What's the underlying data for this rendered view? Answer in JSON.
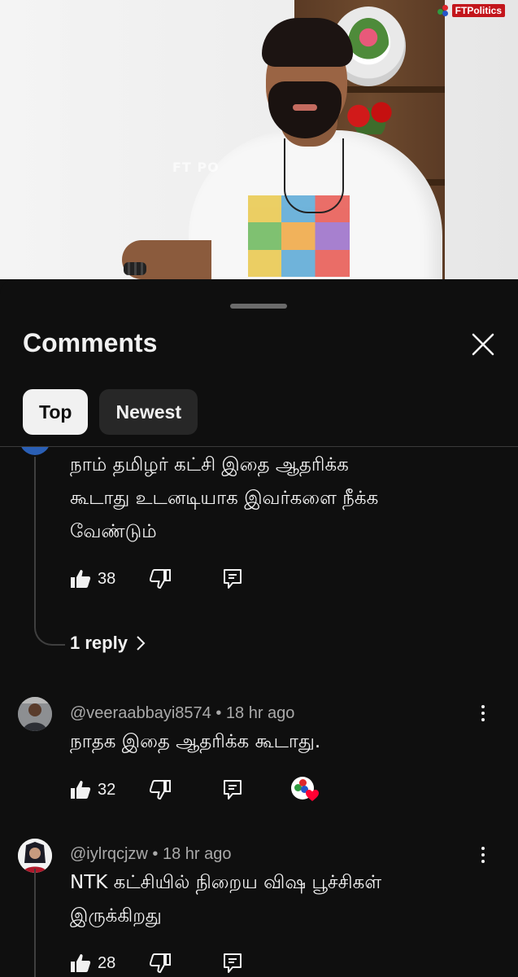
{
  "video": {
    "watermark_center": "FT PO",
    "channel_logo_text": "FTPolitics"
  },
  "sheet": {
    "title": "Comments",
    "sort_chips": [
      {
        "label": "Top",
        "selected": true
      },
      {
        "label": "Newest",
        "selected": false
      }
    ]
  },
  "comments": [
    {
      "text_line1": "நாம் தமிழர் கட்சி இதை ஆதரிக்க",
      "text_line2": "கூடாது உடனடியாக இவர்களை நீக்க",
      "text_line3": "வேண்டும்",
      "likes": "38",
      "replies_label": "1 reply"
    },
    {
      "author": "@veeraabbayi8574",
      "time": "18 hr ago",
      "meta_sep": "•",
      "text_line1": "நாதக இதை ஆதரிக்க கூடாது.",
      "likes": "32",
      "creator_heart": true
    },
    {
      "author": "@iylrqcjzw",
      "time": "18 hr ago",
      "meta_sep": "•",
      "text_line1": "NTK கட்சியில் நிறைய விஷ பூச்சிகள்",
      "text_line2": "இருக்கிறது",
      "likes": "28"
    }
  ],
  "colors": {
    "background": "#0f0f0f",
    "text": "#f1f1f1",
    "secondary_text": "#aaaaaa",
    "chip_active_bg": "#f1f1f1",
    "chip_inactive_bg": "#272727",
    "heart": "#ff0033"
  },
  "icons": [
    "close-icon",
    "like-icon",
    "dislike-icon",
    "reply-icon",
    "chevron-right-icon",
    "more-vert-icon",
    "heart-icon"
  ]
}
